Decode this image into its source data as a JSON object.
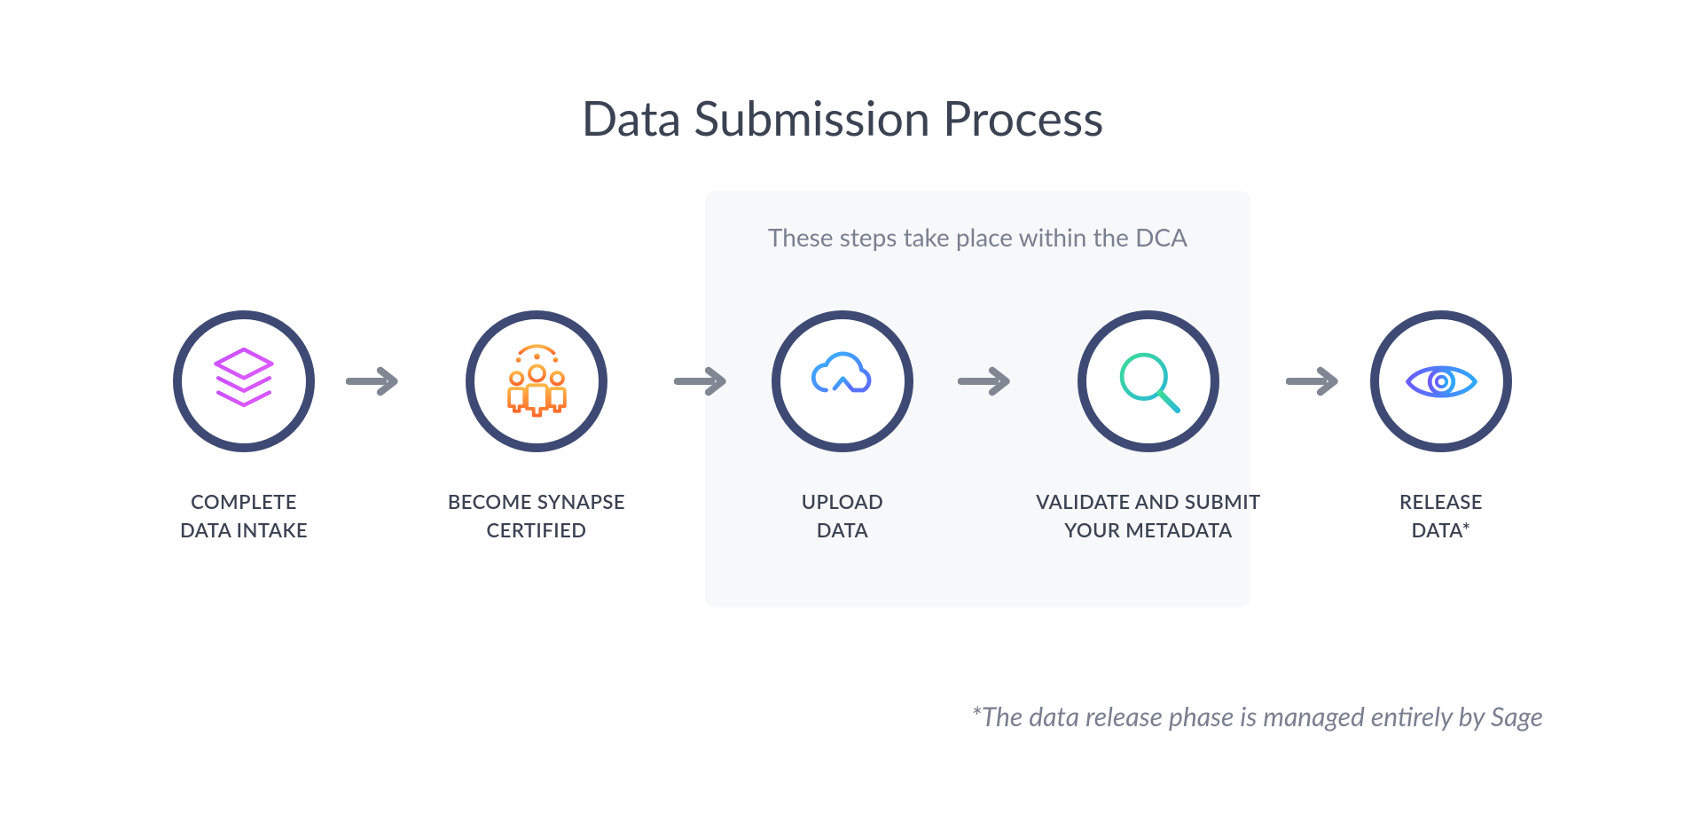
{
  "title": "Data Submission Process",
  "dca_caption": "These steps take place within the DCA",
  "steps": [
    {
      "icon": "layers-icon",
      "label": "COMPLETE\nDATA INTAKE"
    },
    {
      "icon": "people-icon",
      "label": "BECOME SYNAPSE\nCERTIFIED"
    },
    {
      "icon": "cloud-upload-icon",
      "label": "UPLOAD\nDATA"
    },
    {
      "icon": "magnify-plus-icon",
      "label": "VALIDATE AND SUBMIT\nYOUR METADATA"
    },
    {
      "icon": "eye-icon",
      "label": "RELEASE\nDATA*"
    }
  ],
  "footnote": "*The data release phase is managed entirely by Sage",
  "colors": {
    "circle_border": "#3e4a73",
    "arrow": "#808793",
    "dca_bg": "#f7f8fa",
    "text_primary": "#3b4252",
    "text_muted": "#7a8090"
  }
}
